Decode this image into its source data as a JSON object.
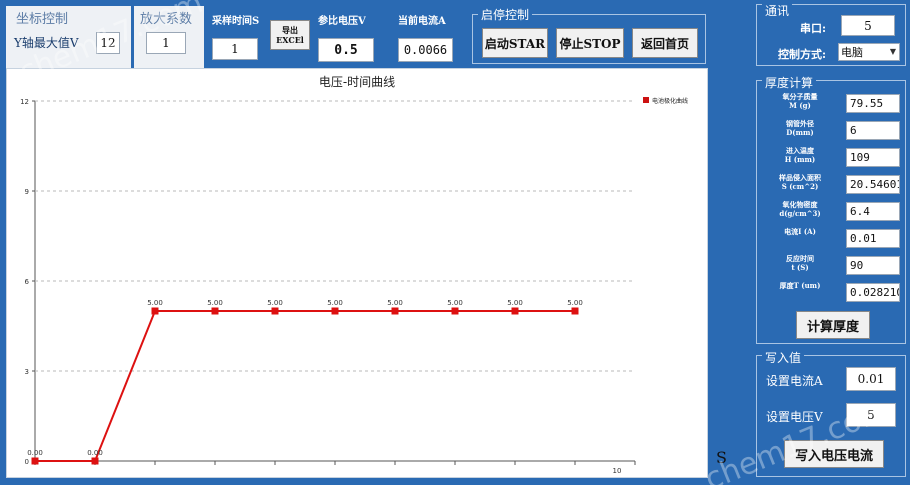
{
  "axis_control": {
    "title": "坐标控制",
    "ymax_label": "Y轴最大值V",
    "ymax_value": "12"
  },
  "zoom": {
    "title": "放大系数",
    "value": "1"
  },
  "sampling": {
    "label": "采样时间S",
    "value": "1"
  },
  "export_button": {
    "line1": "导出",
    "line2": "EXCEl"
  },
  "ref_voltage": {
    "label": "参比电压V",
    "value": "0.5"
  },
  "current": {
    "label": "当前电流A",
    "value": "0.0066"
  },
  "start_stop": {
    "title": "启停控制",
    "start_label": "启动STAR",
    "stop_label": "停止STOP",
    "home_label": "返回首页"
  },
  "comm": {
    "title": "通讯",
    "port_label": "串口:",
    "port_value": "5",
    "mode_label": "控制方式:",
    "mode_value": "电脑"
  },
  "thickness": {
    "title": "厚度计算",
    "fields": [
      {
        "label1": "氧分子质量",
        "label2": "M (g)",
        "value": "79.55"
      },
      {
        "label1": "钢管外径",
        "label2": "D(mm)",
        "value": "6"
      },
      {
        "label1": "进入温度",
        "label2": "H (mm)",
        "value": "109"
      },
      {
        "label1": "样品侵入面积",
        "label2": "S (cm^2)",
        "value": "20.54601"
      },
      {
        "label1": "氧化物密度",
        "label2": "d(g/cm^3)",
        "value": "6.4"
      },
      {
        "label1": "电流I (A)",
        "label2": "",
        "value": "0.01"
      },
      {
        "label1": "反应时间",
        "label2": "t (S)",
        "value": "90"
      },
      {
        "label1": "厚度T (um)",
        "label2": "",
        "value": "0.028210"
      }
    ],
    "calc_label": "计算厚度"
  },
  "write": {
    "title": "写入值",
    "current_label": "设置电流A",
    "current_value": "0.01",
    "voltage_label": "设置电压V",
    "voltage_value": "5",
    "write_label": "写入电压电流"
  },
  "side_marker": "S",
  "watermarks": [
    "chem17.com",
    "chem17.com"
  ],
  "chart_data": {
    "type": "line",
    "title": "电压-时间曲线",
    "legend": "电池极化曲线",
    "legend_position": "top-right",
    "xlim": [
      0,
      10
    ],
    "ylim": [
      0,
      12
    ],
    "yticks": [
      "0",
      "3",
      "6",
      "9",
      "12"
    ],
    "xtick_label": "10",
    "grid": true,
    "color": "#dd1111",
    "series": [
      {
        "name": "电池极化曲线",
        "x": [
          0,
          1,
          2,
          3,
          4,
          5,
          6,
          7,
          8,
          9
        ],
        "y": [
          0,
          0,
          5,
          5,
          5,
          5,
          5,
          5,
          5,
          5
        ],
        "labels": [
          "0.00",
          "0.00",
          "5.00",
          "5.00",
          "5.00",
          "5.00",
          "5.00",
          "5.00",
          "5.00",
          "5.00"
        ]
      }
    ]
  }
}
